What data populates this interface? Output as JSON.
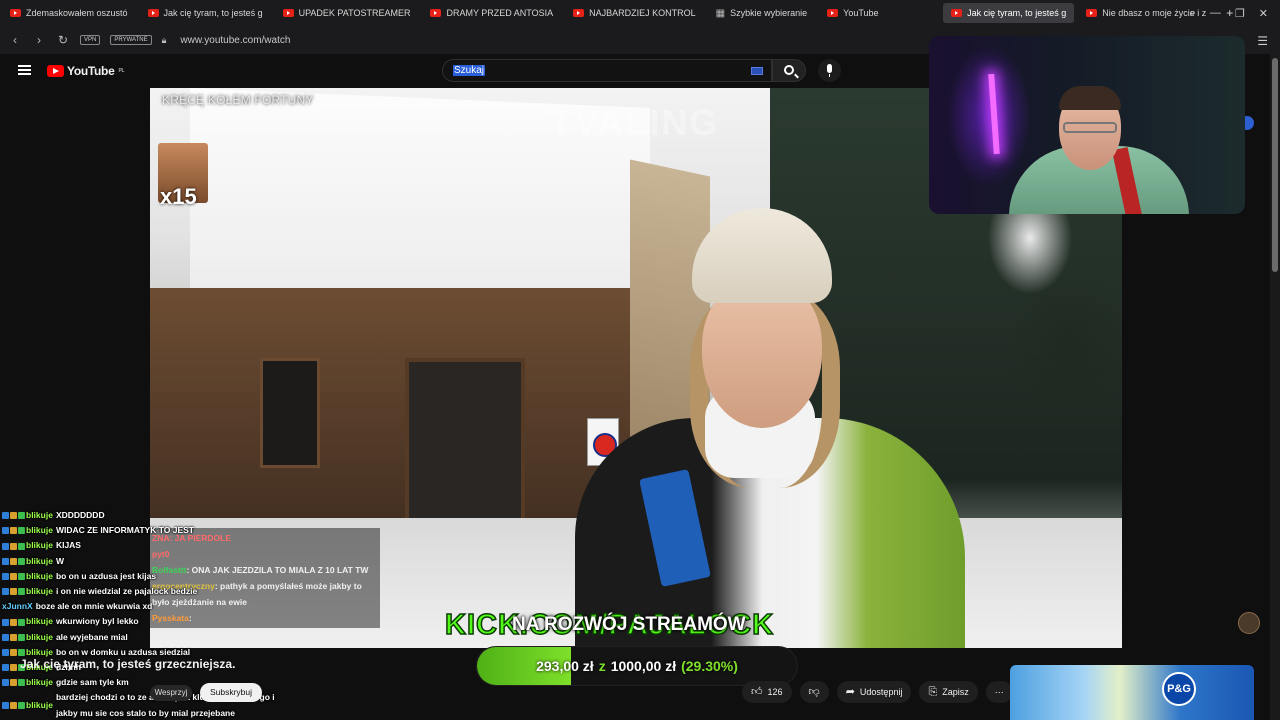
{
  "browser": {
    "tabs": [
      {
        "label": "Zdemaskowałem oszustó",
        "active": false
      },
      {
        "label": "Jak cię tyram, to jesteś g",
        "active": false
      },
      {
        "label": "UPADEK PATOSTREAMER",
        "active": false
      },
      {
        "label": "DRAMY PRZED ANTOSIA",
        "active": false
      },
      {
        "label": "NAJBARDZIEJ KONTROL",
        "active": false
      },
      {
        "label": "Szybkie wybieranie",
        "active": false
      },
      {
        "label": "YouTube",
        "active": false
      },
      {
        "label": "Jak cię tyram, to jesteś g",
        "active": true
      },
      {
        "label": "Nie dbasz o moje życie i z",
        "active": false
      }
    ],
    "new_tab": "+",
    "vpn_badge": "VPN",
    "private_badge": "PRYWATNE",
    "url": "www.youtube.com/watch"
  },
  "youtube": {
    "logo_text": "YouTube",
    "region": "PL",
    "search_value": "Szukaj"
  },
  "video": {
    "stream_title": "KRĘCĘ KOŁEM FORTUNY",
    "watermark": "TVALING",
    "emote_multiplier": "x15",
    "kick_text": "KICK.COM/PAJALOCK",
    "overlay_text": "NA ROZWÓJ STREAMÓW",
    "overlay_chat": [
      {
        "user": "",
        "text": "ZNA: JA PIERDOLE",
        "cls": "u1"
      },
      {
        "user": "pyt0",
        "text": "",
        "cls": "u1"
      },
      {
        "user": "Bolfasttt",
        "text": ": ONA JAK JEZDZILA TO MIALA Z 10 LAT TW",
        "cls": "u2"
      },
      {
        "user": "ergocentryczny",
        "text": ": pathyk a pomyślałeś może jakby to było zjeżdżanie na ewie",
        "cls": "u3"
      },
      {
        "user": "Pysskata",
        "text": ":",
        "cls": "u4"
      }
    ]
  },
  "goal": {
    "current": "293,00 zł",
    "sep": "z",
    "target": "1000,00 zł",
    "percent_label": "(29.30%)",
    "progress": 0.293
  },
  "chat": [
    {
      "user": "blikuje",
      "text": "XDDDDDDD"
    },
    {
      "user": "blikuje",
      "text": "WIDAC ZE INFORMATYK TO JEST"
    },
    {
      "user": "blikuje",
      "text": "KIJAS"
    },
    {
      "user": "blikuje",
      "text": "W"
    },
    {
      "user": "blikuje",
      "text": "bo on u azdusa jest kijas"
    },
    {
      "user": "blikuje",
      "text": "i on nie wiedzial ze pajalock bedzie"
    },
    {
      "user": "xJunnX",
      "text": "boze ale on mnie wkurwia xd",
      "alt": true
    },
    {
      "user": "blikuje",
      "text": "wkurwiony byl lekko"
    },
    {
      "user": "blikuje",
      "text": "ale wyjebane mial"
    },
    {
      "user": "blikuje",
      "text": "bo on w domku u azdusa siedzial"
    },
    {
      "user": "blikuje",
      "text": "dzhhh"
    },
    {
      "user": "blikuje",
      "text": "gdzie sam tyle km"
    },
    {
      "user": "blikuje",
      "text": "bardziej chodzi o to ze azdus jest kluczowy dla niego i jakby mu sie cos stalo to by mial przejebane"
    }
  ],
  "watch": {
    "title": "Jak cię tyram, to jesteś grzeczniejsza.",
    "support_label": "Wesprzyj",
    "subscribe_label": "Subskrybuj",
    "likes": "126",
    "share_label": "Udostępnij",
    "save_label": "Zapisz",
    "more": "⋯"
  },
  "ad": {
    "brand": "P&G"
  },
  "colors": {
    "yt_red": "#ff0000",
    "kick_green": "#53fc18",
    "goal_green": "#7ee02a"
  }
}
